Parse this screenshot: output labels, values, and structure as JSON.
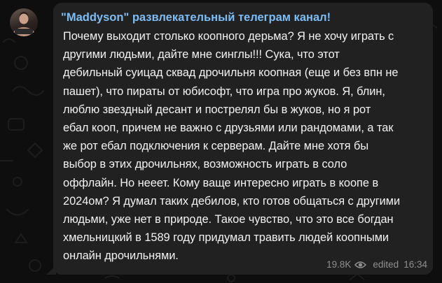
{
  "channel": {
    "title": "\"Maddyson\" развлекательный телеграм канал!"
  },
  "message": {
    "lines": [
      "Почему выходит столько коопного дерьма? Я не хочу играть с",
      "другими людьми, дайте мне синглы!!! Сука, что этот",
      "дебильный суицад сквад дрочильня коопная (еще и без впн не",
      "пашет), что пираты от юбисофт, что игра про жуков. Я, блин,",
      "люблю звездный десант и пострелял бы в жуков, но я рот",
      "ебал кооп, причем не важно с друзьями или рандомами, а так",
      "же рот ебал подключения к серверам. Дайте мне хотя бы",
      "выбор в этих дрочильнях, возможность играть в соло",
      "оффлайн. Но нееет. Кому ваще интересно играть в коопе в",
      "2024ом? Я думал таких дебилов, кто готов общаться с другими",
      "людьми, уже нет в природе. Такое чувство, что это все богдан",
      "хмельницкий в 1589 году придумал травить людей коопными",
      "онлайн дрочильнями."
    ],
    "views": "19.8K",
    "edited_label": "edited",
    "time": "16:34"
  },
  "icons": {
    "views": "eye-icon"
  },
  "colors": {
    "background": "#0e0e0e",
    "bubble": "#212121",
    "channel_title": "#7dbdf5",
    "text": "#f2f2f2",
    "meta": "#8f8f8f"
  }
}
